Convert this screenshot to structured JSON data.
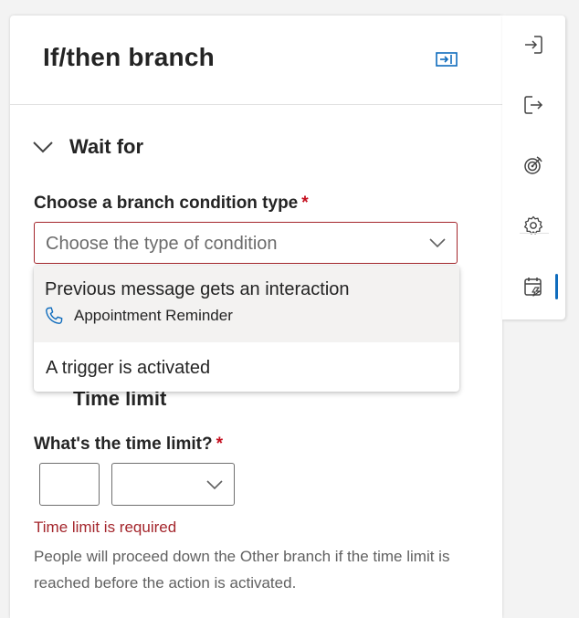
{
  "panel": {
    "title": "If/then branch",
    "section_title": "Wait for"
  },
  "condition_field": {
    "label": "Choose a branch condition type",
    "required_mark": "*",
    "placeholder": "Choose the type of condition",
    "options": [
      {
        "label": "Previous message gets an interaction",
        "sublabel": "Appointment Reminder",
        "icon": "phone-icon",
        "highlighted": true
      },
      {
        "label": "A trigger is activated"
      }
    ]
  },
  "hidden_section": {
    "title": "Time limit"
  },
  "time_limit_field": {
    "label": "What's the time limit?",
    "required_mark": "*",
    "value": "",
    "unit": "",
    "error": "Time limit is required",
    "help": "People will proceed down the Other branch if the time limit is reached before the action is activated."
  },
  "side_rail": {
    "items": [
      "enter-icon",
      "exit-icon",
      "target-icon",
      "gear-icon",
      "calendar-edit-icon"
    ],
    "active_item": "calendar-edit-icon"
  },
  "colors": {
    "accent": "#0f6cbd",
    "error": "#a4262c",
    "required": "#c50f1f"
  }
}
